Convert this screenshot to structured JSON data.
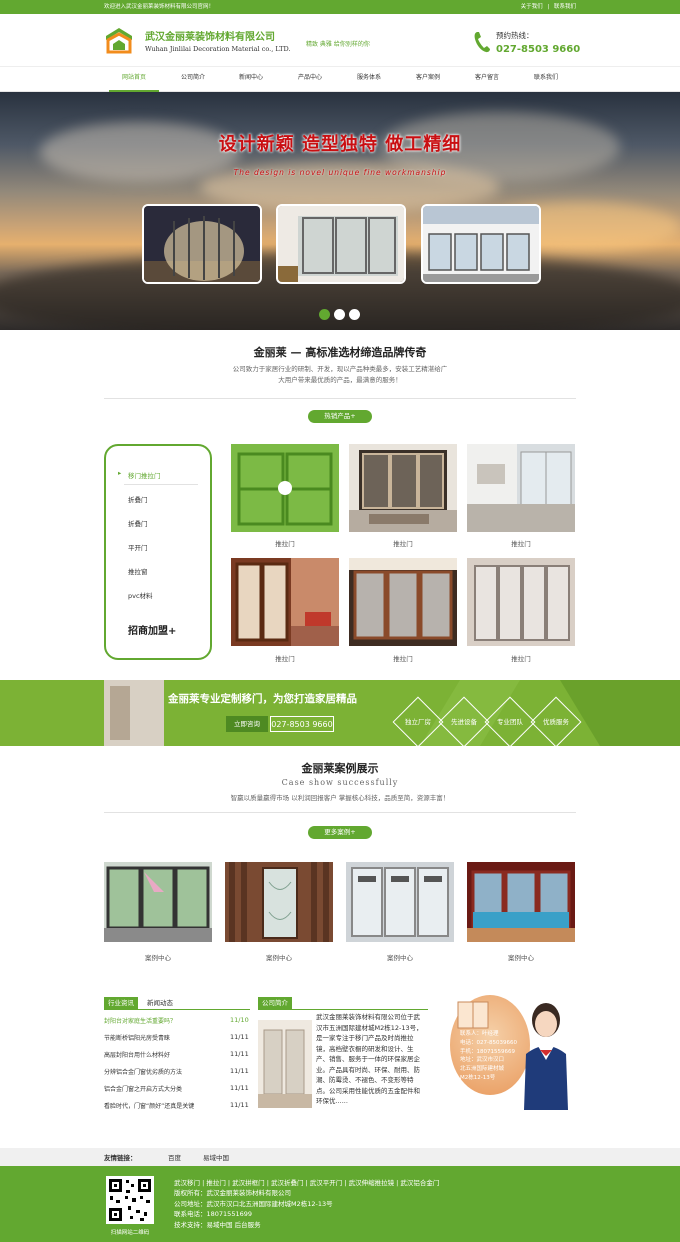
{
  "topbar": {
    "welcome": "欢迎进入武汉金丽莱装饰材料有限公司官网！",
    "about_link": "关于我们",
    "separator": "|",
    "contact_link": "联系我们"
  },
  "header": {
    "company_cn": "武汉金丽莱装饰材料有限公司",
    "company_en": "Wuhan Jinlilai Decoration Material co., LTD.",
    "slogan": "精致 典雅 给你别样的你",
    "phone_label": "预约热线：",
    "phone": "027-8503 9660"
  },
  "nav": [
    "网站首页",
    "公司简介",
    "新闻中心",
    "产品中心",
    "服务体系",
    "客户案例",
    "客户留言",
    "联系我们"
  ],
  "banner": {
    "title": "设计新颖  造型独特  做工精细",
    "subtitle": "The design is novel unique fine workmanship",
    "slide_count": 3,
    "active_slide": 0
  },
  "brand": {
    "title": "金丽莱 — 高标准选材缔造品牌传奇",
    "desc": "公司致力于家居行业的研制、开发，现以产品种类最多，安装工艺精湛给广大用户带来最优质的产品，最满意的服务！"
  },
  "products": {
    "button": "热销产品+",
    "sidebar": {
      "heading": "移门推拉门",
      "items": [
        "折叠门",
        "折叠门",
        "平开门",
        "推拉窗",
        "pvc材料"
      ],
      "cta": "招商加盟+"
    },
    "items": [
      {
        "caption": "推拉门"
      },
      {
        "caption": "推拉门"
      },
      {
        "caption": "推拉门"
      },
      {
        "caption": "推拉门"
      },
      {
        "caption": "推拉门"
      },
      {
        "caption": "推拉门"
      }
    ]
  },
  "promo": {
    "title": "金丽莱专业定制移门，为您打造家居精品",
    "button": "立即咨询",
    "phone": "027-8503 9660",
    "features": [
      "独立厂房",
      "先进设备",
      "专业团队",
      "优质服务"
    ]
  },
  "cases": {
    "title": "金丽莱案例展示",
    "title_en": "Case show successfully",
    "desc": "智赢以质量赢得市场  以利润回报客户  掌握核心科技，品质至简，资源丰富！",
    "button": "更多案例+",
    "items": [
      {
        "caption": "案例中心"
      },
      {
        "caption": "案例中心"
      },
      {
        "caption": "案例中心"
      },
      {
        "caption": "案例中心"
      }
    ]
  },
  "news": {
    "tabs": [
      "行业资讯",
      "新闻动态"
    ],
    "items": [
      {
        "title": "封阳台对家庭生活重要吗？",
        "date": "11/10"
      },
      {
        "title": "节能断桥铝阳光房受青睐",
        "date": "11/11"
      },
      {
        "title": "高层封阳台用什么材料好",
        "date": "11/11"
      },
      {
        "title": "分辨铝合金门窗优劣质的方法",
        "date": "11/11"
      },
      {
        "title": "铝合金门窗之开启方式大分类",
        "date": "11/11"
      },
      {
        "title": "看脸时代，门窗“颜好”还真是关键",
        "date": "11/11"
      }
    ]
  },
  "about": {
    "tab": "公司简介",
    "text": "武汉金丽莱装饰材料有限公司位于武汉市五洲国际建材城M2栋12-13号，是一家专注于移门产品及时尚推拉镜，高档壁衣橱的研发和设计、生产、销售、服务于一体的环保家居企业。产品具有时尚、环保、耐用、防潮、防霉烫、不褪色、不变形等特点。公司采用性能优质的五金配件和环保优......"
  },
  "contact": {
    "lines": [
      "联系人：叶经理",
      "电话：027-85039660",
      "手机：18071559669",
      "地址：武汉市汉口",
      "北五洲国际建材城",
      "M2栋12-13号"
    ]
  },
  "links": {
    "label": "友情链接：",
    "items": [
      "百度",
      "易域中国"
    ]
  },
  "footer": {
    "nav": "武汉移门 | 推拉门 | 武汉拼框门 | 武汉折叠门 | 武汉平开门 | 武汉伸缩推拉镜 | 武汉铝合金门",
    "rights": "版权所有：武汉金丽莱装饰材料有限公司",
    "address": "公司地址：武汉市汉口北五洲国际建材城M2栋12-13号",
    "phone": "联系电话：18071551699",
    "support": "技术支持：易域中国    后台服务",
    "qr_caption": "扫描网站二维码"
  },
  "colors": {
    "accent": "#62a830",
    "banner_title": "#c90f12"
  }
}
